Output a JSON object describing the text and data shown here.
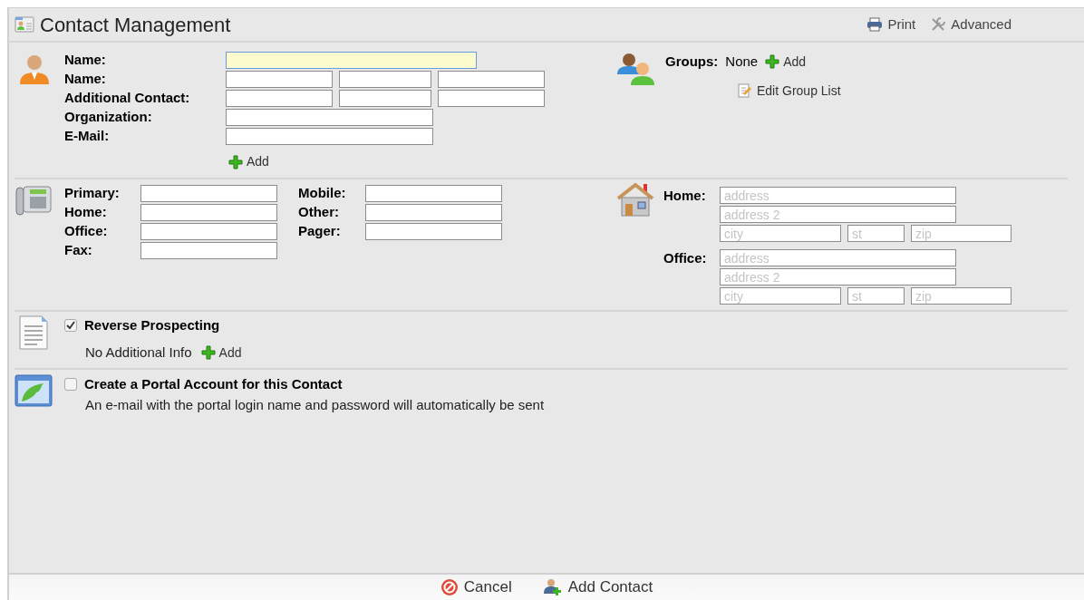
{
  "header": {
    "title": "Contact Management",
    "actions": [
      {
        "label": "Print",
        "kind": "print"
      },
      {
        "label": "Advanced",
        "kind": "advanced"
      }
    ]
  },
  "contact": {
    "rows": [
      {
        "label": "Name:",
        "fields": [
          {
            "kind": "wide",
            "focused": true
          }
        ]
      },
      {
        "label": "Name:",
        "fields": [
          {
            "kind": "long",
            "focused": false
          },
          {
            "kind": "short",
            "focused": false
          },
          {
            "kind": "long",
            "focused": false
          }
        ]
      },
      {
        "label": "Additional Contact:",
        "fields": [
          {
            "kind": "long",
            "focused": false
          },
          {
            "kind": "short",
            "focused": false
          },
          {
            "kind": "long",
            "focused": false
          }
        ]
      },
      {
        "label": "Organization:",
        "fields": [
          {
            "kind": "medium",
            "focused": false
          }
        ]
      },
      {
        "label": "E-Mail:",
        "fields": [
          {
            "kind": "medium",
            "focused": false
          }
        ]
      }
    ],
    "add_link": "Add"
  },
  "groups": {
    "label": "Groups:",
    "value": "None",
    "add_link": "Add",
    "edit_link": "Edit Group List"
  },
  "phones": {
    "columns": [
      [
        {
          "label": "Primary:"
        },
        {
          "label": "Home:"
        },
        {
          "label": "Office:"
        },
        {
          "label": "Fax:"
        }
      ],
      [
        {
          "label": "Mobile:"
        },
        {
          "label": "Other:"
        },
        {
          "label": "Pager:"
        }
      ]
    ]
  },
  "addresses": [
    {
      "label": "Home:",
      "fields": [
        {
          "kind": "line",
          "placeholder": "address"
        },
        {
          "kind": "line",
          "placeholder": "address 2"
        },
        {
          "kind": "city",
          "placeholder": "city"
        },
        {
          "kind": "state",
          "placeholder": "st"
        },
        {
          "kind": "zip",
          "placeholder": "zip"
        }
      ]
    },
    {
      "label": "Office:",
      "fields": [
        {
          "kind": "line",
          "placeholder": "address"
        },
        {
          "kind": "line",
          "placeholder": "address 2"
        },
        {
          "kind": "city",
          "placeholder": "city"
        },
        {
          "kind": "state",
          "placeholder": "st"
        },
        {
          "kind": "zip",
          "placeholder": "zip"
        }
      ]
    }
  ],
  "prospecting": {
    "label": "Reverse Prospecting",
    "checked": true,
    "info": "No Additional Info",
    "add_link": "Add"
  },
  "portal": {
    "label": "Create a Portal Account for this Contact",
    "checked": false,
    "note": "An e-mail with the portal login name and password will automatically be sent"
  },
  "footer": {
    "buttons": [
      {
        "label": "Cancel",
        "kind": "cancel"
      },
      {
        "label": "Add Contact",
        "kind": "add"
      }
    ]
  }
}
